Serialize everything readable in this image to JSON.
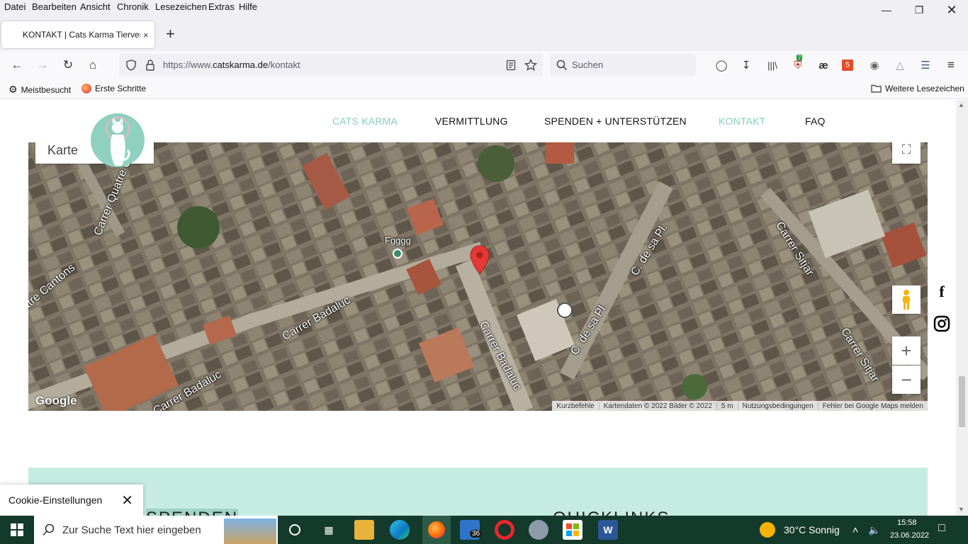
{
  "menubar": {
    "items": [
      "Datei",
      "Bearbeiten",
      "Ansicht",
      "Chronik",
      "Lesezeichen",
      "Extras",
      "Hilfe"
    ]
  },
  "tab": {
    "title": "KONTAKT | Cats Karma Tierverm",
    "close": "×"
  },
  "urlbar": {
    "prefix": "https://www.",
    "domain": "catskarma.de",
    "path": "/kontakt"
  },
  "search": {
    "placeholder": "Suchen"
  },
  "toolbar": {
    "shield_badge": "7"
  },
  "bookmarks": {
    "items": [
      "Meistbesucht",
      "Erste Schritte"
    ],
    "other": "Weitere Lesezeichen"
  },
  "site": {
    "nav": [
      "CATS KARMA",
      "VERMITTLUNG",
      "SPENDEN + UNTERSTÜTZEN",
      "KONTAKT",
      "FAQ"
    ],
    "accent_color": "#85ccba"
  },
  "map": {
    "type_label": "Karte",
    "poi_label": "Fgggg",
    "streets": [
      "Carrer Quatre C",
      "atre Cantons",
      "Carrer Badaluc",
      "Carrer Badaluc",
      "Carrer Badaluc",
      "C. de sa Pl.",
      "C. de sa Pl.",
      "Carrer Sitjar",
      "Carrer Sitjar"
    ],
    "logo": "Google",
    "footer": [
      "Kurzbefehle",
      "Kartendaten © 2022 Bilder © 2022",
      "5 m",
      "Nutzungsbedingungen",
      "Fehler bei Google Maps melden"
    ]
  },
  "footer_band": {
    "headings": [
      "SPENDEN",
      "QUICKLINKS"
    ]
  },
  "cookie": {
    "label": "Cookie-Einstellungen"
  },
  "taskbar": {
    "search_placeholder": "Zur Suche Text hier eingeben",
    "mail_badge": "36",
    "weather": "30°C  Sonnig",
    "time": "15:58",
    "date": "23.06.2022"
  }
}
